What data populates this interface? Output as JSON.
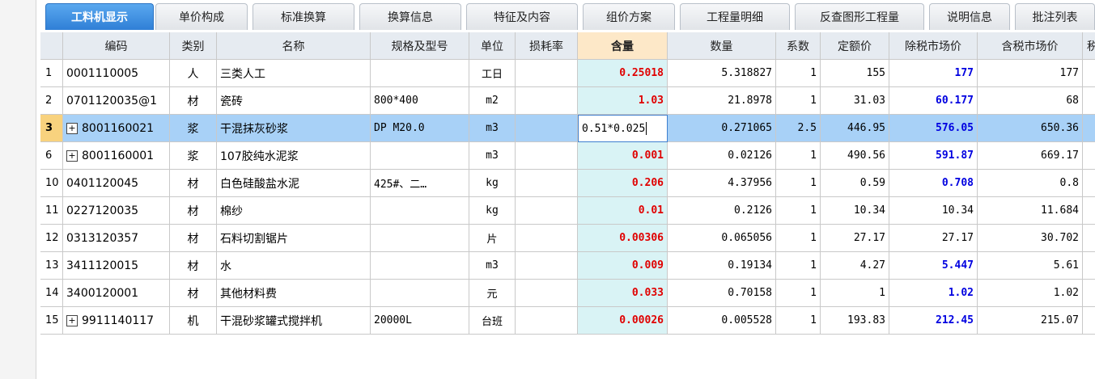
{
  "tabs": [
    "工料机显示",
    "单价构成",
    "标准换算",
    "换算信息",
    "特征及内容",
    "组价方案",
    "工程量明细",
    "反查图形工程量",
    "说明信息",
    "批注列表"
  ],
  "active_tab": 0,
  "columns": [
    "",
    "编码",
    "类别",
    "名称",
    "规格及型号",
    "单位",
    "损耗率",
    "含量",
    "数量",
    "系数",
    "定额价",
    "除税市场价",
    "含税市场价",
    "税"
  ],
  "rows": [
    {
      "idx": "1",
      "expand": "",
      "code": "0001110005",
      "type": "人",
      "name": "三类人工",
      "spec": "",
      "unit": "工日",
      "loss": "",
      "qty": "0.25018",
      "amount": "5.318827",
      "coef": "1",
      "quota": "155",
      "excl": "177",
      "incl": "177",
      "excl_blue": true
    },
    {
      "idx": "2",
      "expand": "",
      "code": "0701120035@1",
      "type": "材",
      "name": "瓷砖",
      "spec": "800*400",
      "unit": "m2",
      "loss": "",
      "qty": "1.03",
      "amount": "21.8978",
      "coef": "1",
      "quota": "31.03",
      "excl": "60.177",
      "incl": "68",
      "excl_blue": true
    },
    {
      "idx": "3",
      "expand": "+",
      "code": "8001160021",
      "type": "浆",
      "name": "干混抹灰砂浆",
      "spec": "DP M20.0",
      "unit": "m3",
      "loss": "",
      "qty": "0.51*0.025",
      "amount": "0.271065",
      "coef": "2.5",
      "quota": "446.95",
      "excl": "576.05",
      "incl": "650.36",
      "excl_blue": true,
      "selected": true
    },
    {
      "idx": "6",
      "expand": "+",
      "code": "8001160001",
      "type": "浆",
      "name": "107胶纯水泥浆",
      "spec": "",
      "unit": "m3",
      "loss": "",
      "qty": "0.001",
      "amount": "0.02126",
      "coef": "1",
      "quota": "490.56",
      "excl": "591.87",
      "incl": "669.17",
      "excl_blue": true
    },
    {
      "idx": "10",
      "expand": "",
      "code": "0401120045",
      "type": "材",
      "name": "白色硅酸盐水泥",
      "spec": "425#、二…",
      "unit": "kg",
      "loss": "",
      "qty": "0.206",
      "amount": "4.37956",
      "coef": "1",
      "quota": "0.59",
      "excl": "0.708",
      "incl": "0.8",
      "excl_blue": true
    },
    {
      "idx": "11",
      "expand": "",
      "code": "0227120035",
      "type": "材",
      "name": "棉纱",
      "spec": "",
      "unit": "kg",
      "loss": "",
      "qty": "0.01",
      "amount": "0.2126",
      "coef": "1",
      "quota": "10.34",
      "excl": "10.34",
      "incl": "11.684",
      "excl_blue": false
    },
    {
      "idx": "12",
      "expand": "",
      "code": "0313120357",
      "type": "材",
      "name": "石料切割锯片",
      "spec": "",
      "unit": "片",
      "loss": "",
      "qty": "0.00306",
      "amount": "0.065056",
      "coef": "1",
      "quota": "27.17",
      "excl": "27.17",
      "incl": "30.702",
      "excl_blue": false
    },
    {
      "idx": "13",
      "expand": "",
      "code": "3411120015",
      "type": "材",
      "name": "水",
      "spec": "",
      "unit": "m3",
      "loss": "",
      "qty": "0.009",
      "amount": "0.19134",
      "coef": "1",
      "quota": "4.27",
      "excl": "5.447",
      "incl": "5.61",
      "excl_blue": true
    },
    {
      "idx": "14",
      "expand": "",
      "code": "3400120001",
      "type": "材",
      "name": "其他材料费",
      "spec": "",
      "unit": "元",
      "loss": "",
      "qty": "0.033",
      "amount": "0.70158",
      "coef": "1",
      "quota": "1",
      "excl": "1.02",
      "incl": "1.02",
      "excl_blue": true
    },
    {
      "idx": "15",
      "expand": "+",
      "code": "9911140117",
      "type": "机",
      "name": "干混砂浆罐式搅拌机",
      "spec": "20000L",
      "unit": "台班",
      "loss": "",
      "qty": "0.00026",
      "amount": "0.005528",
      "coef": "1",
      "quota": "193.83",
      "excl": "212.45",
      "incl": "215.07",
      "excl_blue": true
    }
  ]
}
